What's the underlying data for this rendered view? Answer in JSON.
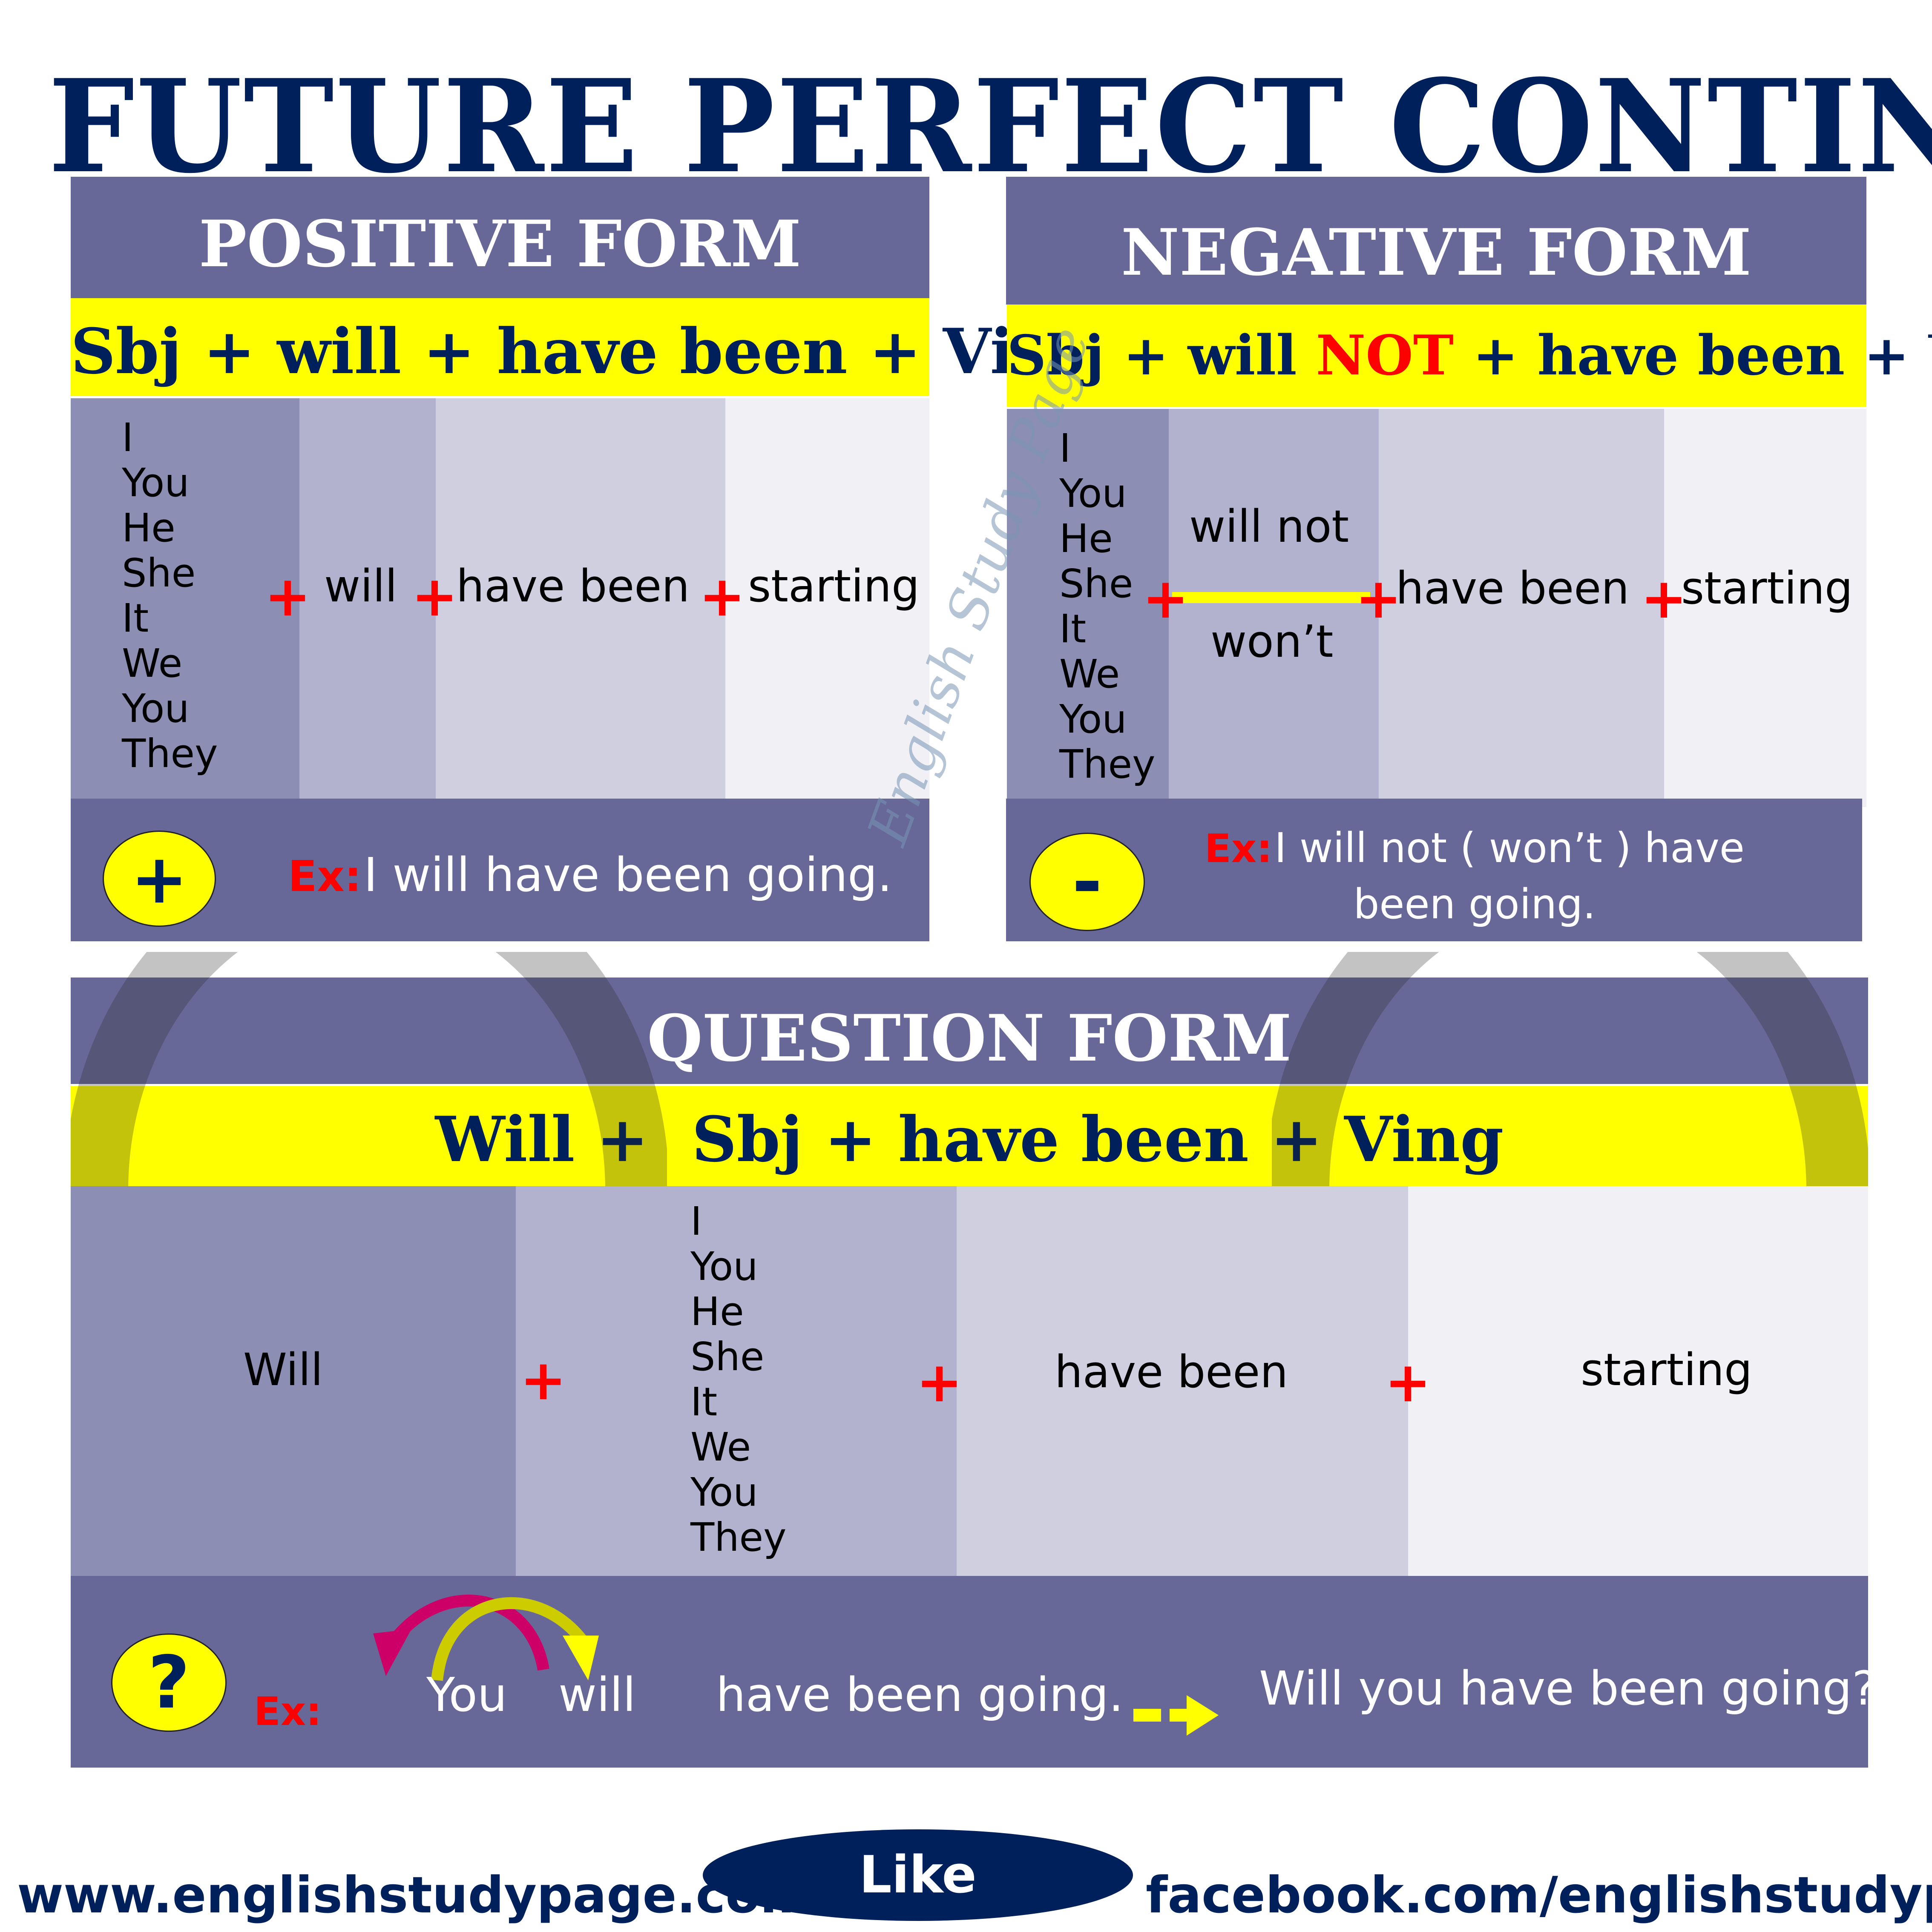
{
  "title": "FUTURE PERFECT CONTINUOUS TENSE",
  "colors": {
    "title_navy": "#00205b",
    "band_purple": "#676897",
    "formula_yellow": "#ffff00",
    "plus_red": "#ff0000",
    "col1": "#8d8eb3",
    "col2": "#b2b2cf",
    "col3": "#cfcfe0",
    "col4": "#f0f0f5"
  },
  "watermarks": {
    "diagonal": "English Study Page",
    "arc": "www.englishstudypage.com"
  },
  "positive": {
    "heading": "POSITIVE FORM",
    "formula": "Sbj + will + have been + Ving",
    "pronouns": [
      "I",
      "You",
      "He",
      "She",
      "It",
      "We",
      "You",
      "They"
    ],
    "aux": "will",
    "have_been": "have been",
    "verb": "starting",
    "plus": "+",
    "badge_symbol": "+",
    "ex_label": "Ex:",
    "example": "I will have been going."
  },
  "negative": {
    "heading": "NEGATIVE FORM",
    "formula_pre": "Sbj + will ",
    "formula_not": "NOT",
    "formula_post": " + have been + Ving",
    "pronouns": [
      "I",
      "You",
      "He",
      "She",
      "It",
      "We",
      "You",
      "They"
    ],
    "aux_full": "will not",
    "aux_short": "won’t",
    "have_been": "have been",
    "verb": "starting",
    "plus": "+",
    "badge_symbol": "-",
    "ex_label": "Ex:",
    "example_line1": "I will not ( won’t ) have",
    "example_line2": "been going."
  },
  "question": {
    "heading": "QUESTION FORM",
    "formula": "Will +  Sbj + have been + Ving",
    "aux": "Will",
    "pronouns": [
      "I",
      "You",
      "He",
      "She",
      "It",
      "We",
      "You",
      "They"
    ],
    "have_been": "have been",
    "verb": "starting",
    "plus": "+",
    "badge_symbol": "?",
    "ex_label": "Ex:",
    "ex_word1": "You",
    "ex_word2": "will",
    "ex_rest": "have been going.",
    "ex_result": "Will you have been going?"
  },
  "footer": {
    "website": "www.englishstudypage.com",
    "like": "Like",
    "facebook": "facebook.com/englishstudypage"
  }
}
